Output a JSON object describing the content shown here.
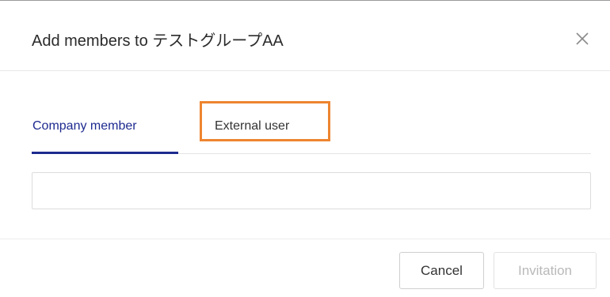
{
  "dialog": {
    "title": "Add members to テストグループAA",
    "close_icon": "close-icon"
  },
  "tabs": [
    {
      "label": "Company member",
      "active": true
    },
    {
      "label": "External user",
      "active": false,
      "highlighted": true
    }
  ],
  "member_input": {
    "value": "",
    "placeholder": ""
  },
  "footer": {
    "cancel_label": "Cancel",
    "invitation_label": "Invitation",
    "invitation_disabled": true
  },
  "colors": {
    "active_tab": "#1d2a8f",
    "highlight": "#ee8530",
    "disabled_text": "#b9b9b9"
  }
}
